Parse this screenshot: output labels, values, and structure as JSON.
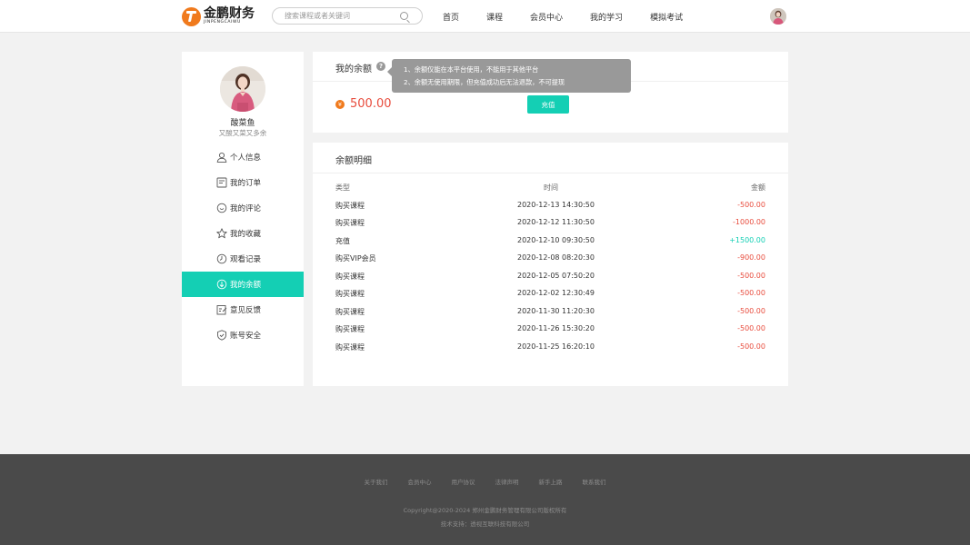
{
  "header": {
    "logo_cn": "金鹏财务",
    "logo_en": "JINPENGCAIWU",
    "search_placeholder": "搜索课程或者关键词",
    "nav": [
      "首页",
      "课程",
      "会员中心",
      "我的学习",
      "模拟考试"
    ]
  },
  "profile": {
    "name": "酸菜鱼",
    "signature": "又酸又菜又多余"
  },
  "menu": [
    {
      "label": "个人信息",
      "icon": "user-icon",
      "active": false
    },
    {
      "label": "我的订单",
      "icon": "order-icon",
      "active": false
    },
    {
      "label": "我的评论",
      "icon": "comment-icon",
      "active": false
    },
    {
      "label": "我的收藏",
      "icon": "star-icon",
      "active": false
    },
    {
      "label": "观看记录",
      "icon": "clock-icon",
      "active": false
    },
    {
      "label": "我的余额",
      "icon": "wallet-icon",
      "active": true
    },
    {
      "label": "意见反馈",
      "icon": "feedback-icon",
      "active": false
    },
    {
      "label": "账号安全",
      "icon": "shield-icon",
      "active": false
    }
  ],
  "balance": {
    "title": "我的余额",
    "help": "?",
    "currency_symbol": "¥",
    "amount": "500.00",
    "recharge_label": "充值",
    "tooltip_line1": "1、余额仅能在本平台使用，不能用于其他平台",
    "tooltip_line2": "2、余额无使用期限，但充值成功后无法退款，不可提现"
  },
  "detail": {
    "title": "余额明细",
    "columns": {
      "type": "类型",
      "time": "时间",
      "amount": "金额"
    },
    "rows": [
      {
        "type": "购买课程",
        "time": "2020-12-13  14:30:50",
        "amount": "-500.00",
        "sign": "neg"
      },
      {
        "type": "购买课程",
        "time": "2020-12-12  11:30:50",
        "amount": "-1000.00",
        "sign": "neg"
      },
      {
        "type": "充值",
        "time": "2020-12-10  09:30:50",
        "amount": "+1500.00",
        "sign": "pos"
      },
      {
        "type": "购买VIP会员",
        "time": "2020-12-08  08:20:30",
        "amount": "-900.00",
        "sign": "neg"
      },
      {
        "type": "购买课程",
        "time": "2020-12-05  07:50:20",
        "amount": "-500.00",
        "sign": "neg"
      },
      {
        "type": "购买课程",
        "time": "2020-12-02  12:30:49",
        "amount": "-500.00",
        "sign": "neg"
      },
      {
        "type": "购买课程",
        "time": "2020-11-30  11:20:30",
        "amount": "-500.00",
        "sign": "neg"
      },
      {
        "type": "购买课程",
        "time": "2020-11-26  15:30:20",
        "amount": "-500.00",
        "sign": "neg"
      },
      {
        "type": "购买课程",
        "time": "2020-11-25  16:20:10",
        "amount": "-500.00",
        "sign": "neg"
      }
    ]
  },
  "footer": {
    "links": [
      "关于我们",
      "会员中心",
      "用户协议",
      "法律声明",
      "新手上路",
      "联系我们"
    ],
    "copyright": "Copyright@2020-2024 郑州金鹏财务管理有限公司版权所有",
    "support": "技术支持：透视互联科技有限公司"
  },
  "colors": {
    "accent": "#14cfb4",
    "negative": "#e84c3d",
    "brand_orange": "#f07a1d",
    "footer_bg": "#4a4a4a"
  }
}
